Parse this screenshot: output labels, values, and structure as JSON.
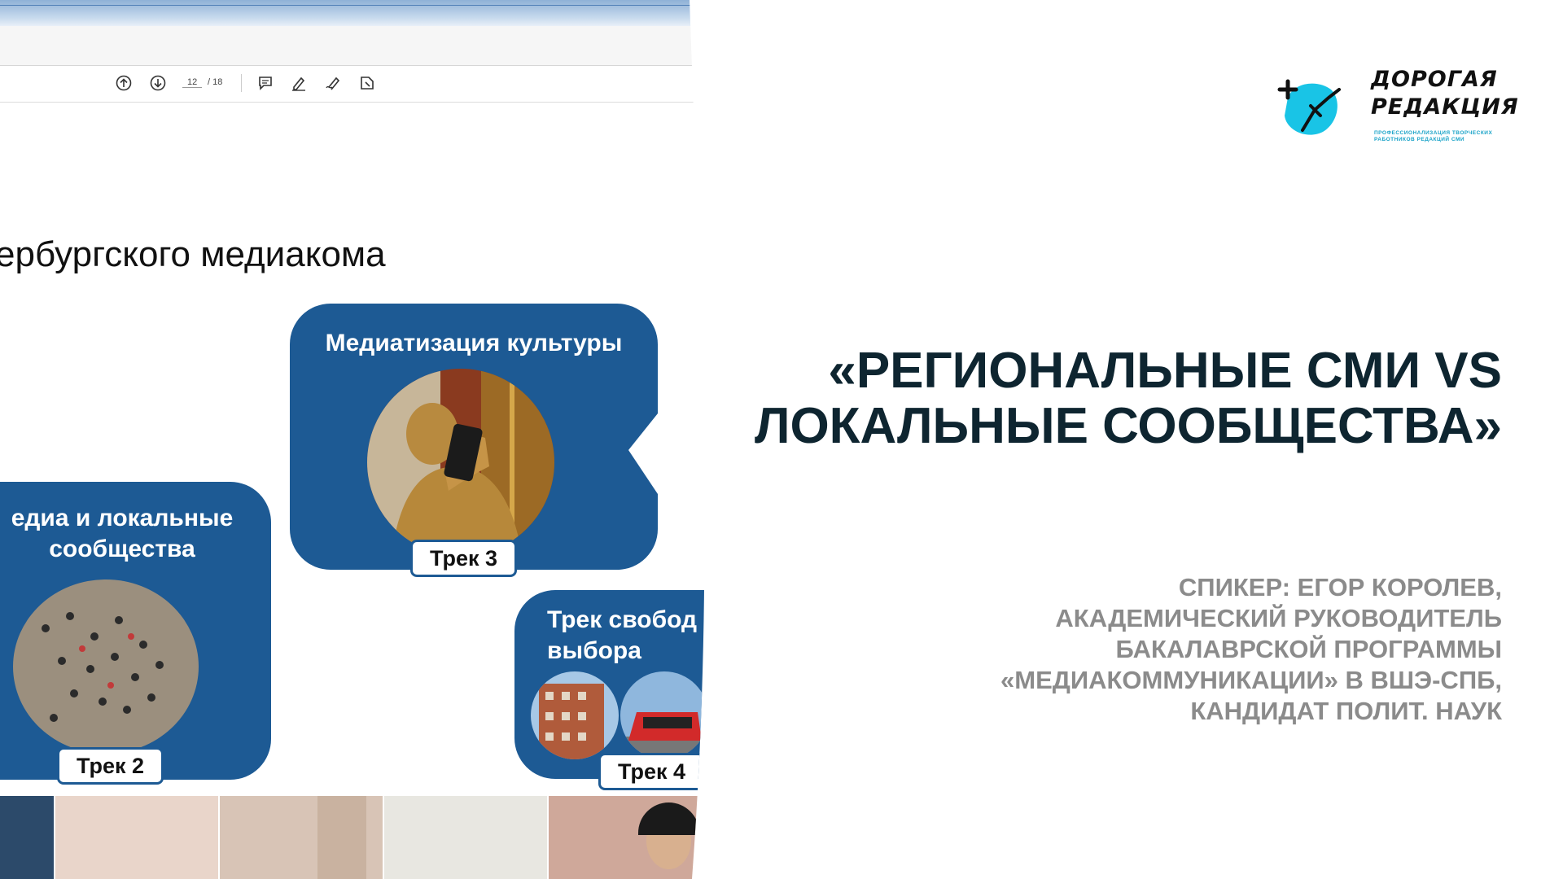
{
  "viewer": {
    "page_current": "12",
    "page_total": "/ 18"
  },
  "slide": {
    "title": "ербургского медиакома",
    "cards": [
      {
        "title": "Медиатизация культуры",
        "tag": "Трек 3"
      },
      {
        "title": "едиа и локальные сообщества",
        "tag": "Трек 2"
      },
      {
        "title": "Трек свобод выбора",
        "tag": "Трек 4"
      }
    ]
  },
  "logo": {
    "line1": "ДОРОГАЯ",
    "line2": "РЕДАКЦИЯ",
    "subtitle": "ПРОФЕССИОНАЛИЗАЦИЯ ТВОРЧЕСКИХ РАБОТНИКОВ РЕДАКЦИЙ СМИ",
    "color_primary": "#19c4e6"
  },
  "headline": {
    "line1": "«РЕГИОНАЛЬНЫЕ СМИ VS",
    "line2": "ЛОКАЛЬНЫЕ СООБЩЕСТВА»"
  },
  "speaker": {
    "line1": "СПИКЕР: ЕГОР КОРОЛЕВ,",
    "line2": "АКАДЕМИЧЕСКИЙ РУКОВОДИТЕЛЬ",
    "line3": "БАКАЛАВРСКОЙ ПРОГРАММЫ",
    "line4": "«МЕДИАКОММУНИКАЦИИ» В ВШЭ-СПБ,",
    "line5": "КАНДИДАТ ПОЛИТ. НАУК"
  },
  "colors": {
    "card_blue": "#1d5a94",
    "headline": "#0e2530",
    "speaker": "#8b8b8b"
  }
}
